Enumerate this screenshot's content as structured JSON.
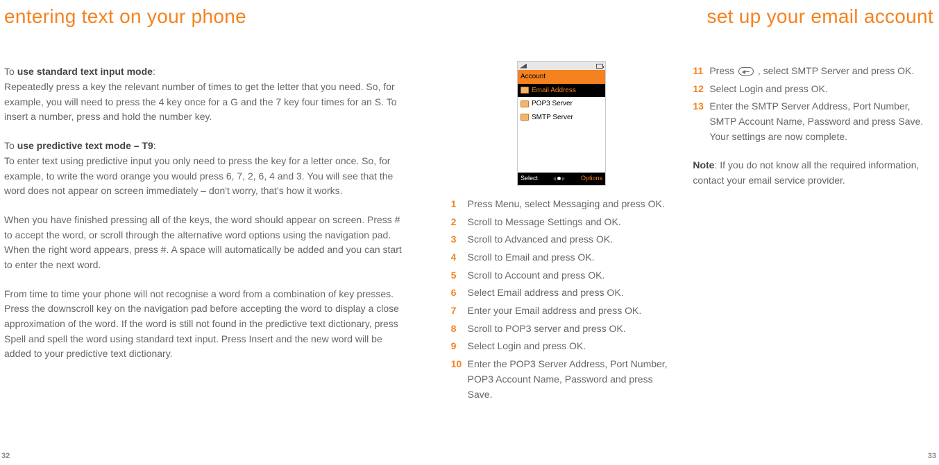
{
  "left": {
    "heading": "entering text on your phone",
    "block1_intro_prefix": "To ",
    "block1_intro_bold": "use standard text input mode",
    "block1_intro_suffix": ":",
    "block1_body": "Repeatedly press a key the relevant number of times to get the letter that you need. So, for example, you will need to press the 4 key once for a G and the 7 key four times for an S. To insert a number, press and hold the number key.",
    "block2_intro_prefix": "To ",
    "block2_intro_bold": "use predictive text mode – T9",
    "block2_intro_suffix": ":",
    "block2_p1": "To enter text using predictive input you only need to press the key for a letter once. So, for example, to write the word orange you would press 6, 7, 2, 6, 4 and 3. You will see that the word does not appear on screen immediately – don't worry, that's how it works.",
    "block2_p2": "When you have finished pressing all of the keys, the word should appear on screen. Press # to accept the word, or scroll through the alternative word options using the navigation pad. When the right word appears, press #. A space will automatically be added and you can start to enter the next word.",
    "block2_p3": "From time to time your phone will not recognise a word from a combination of key presses. Press the downscroll key on the navigation pad before accepting the word to display a close approximation of the word. If the word is still not found in the predictive text dictionary, press Spell and spell the word using standard text input. Press Insert and the new word will be added to your predictive text dictionary.",
    "page_num": "32"
  },
  "right": {
    "heading": "set up your email account",
    "page_num": "33"
  },
  "phone": {
    "title": "Account",
    "rows": [
      {
        "label": "Email Address",
        "selected": true
      },
      {
        "label": "POP3 Server",
        "selected": false
      },
      {
        "label": "SMTP Server",
        "selected": false
      }
    ],
    "left_softkey": "Select",
    "right_softkey": "Options"
  },
  "steps_col1": [
    {
      "n": "1",
      "t": "Press Menu, select Messaging and press OK."
    },
    {
      "n": "2",
      "t": "Scroll to Message Settings and OK."
    },
    {
      "n": "3",
      "t": "Scroll to Advanced and press OK."
    },
    {
      "n": "4",
      "t": "Scroll to Email and press OK."
    },
    {
      "n": "5",
      "t": "Scroll to Account and press OK."
    },
    {
      "n": "6",
      "t": "Select Email address and press OK."
    },
    {
      "n": "7",
      "t": "Enter your Email address and press OK."
    },
    {
      "n": "8",
      "t": "Scroll to POP3 server and press OK."
    },
    {
      "n": "9",
      "t": "Select Login and press OK."
    },
    {
      "n": "10",
      "t": "Enter the POP3 Server Address, Port Number, POP3 Account Name, Password and press Save."
    }
  ],
  "steps_col2": [
    {
      "n": "11",
      "t_before": "Press ",
      "t_after": " , select SMTP Server and press OK.",
      "has_icon": true
    },
    {
      "n": "12",
      "t": "Select Login and press OK."
    },
    {
      "n": "13",
      "t": "Enter the SMTP Server Address, Port Number, SMTP Account Name, Password and press Save. Your settings are now complete."
    }
  ],
  "note_bold": "Note",
  "note_text": ": If you do not know all the required information, contact your email service provider."
}
